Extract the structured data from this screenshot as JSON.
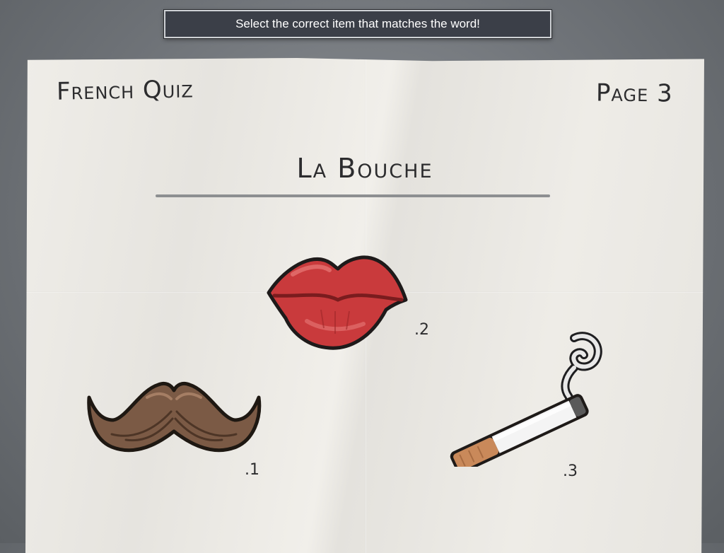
{
  "instruction": "Select the correct item that matches the word!",
  "paper": {
    "title": "French Quiz",
    "page_label": "Page 3",
    "word": "La Bouche"
  },
  "options": [
    {
      "icon": "mustache-icon",
      "label": ".1"
    },
    {
      "icon": "lips-icon",
      "label": ".2"
    },
    {
      "icon": "cigarette-icon",
      "label": ".3"
    }
  ],
  "colors": {
    "background": "#6f7378",
    "instruction_bg": "#3b3f48",
    "paper": "#ece9e4",
    "ink": "#2c2c2e",
    "lips": "#c8383a",
    "mustache": "#7a5a44",
    "cigarette_filter": "#c88a5a"
  }
}
